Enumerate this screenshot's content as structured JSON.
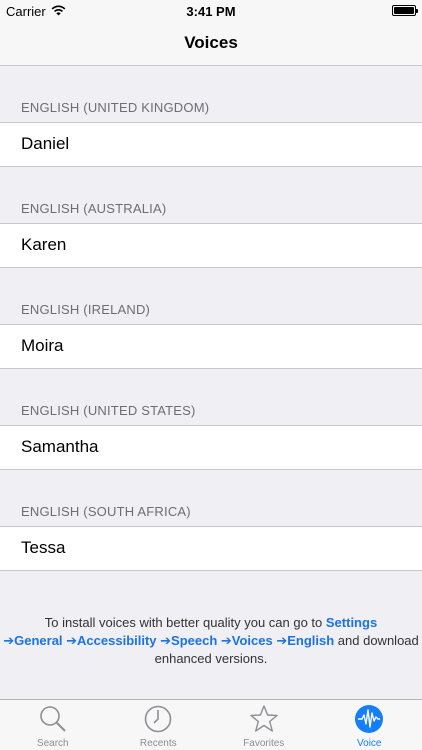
{
  "status": {
    "carrier": "Carrier",
    "time": "3:41 PM"
  },
  "nav": {
    "title": "Voices"
  },
  "sections": [
    {
      "header": "ENGLISH (UNITED KINGDOM)",
      "voice": "Daniel"
    },
    {
      "header": "ENGLISH (AUSTRALIA)",
      "voice": "Karen"
    },
    {
      "header": "ENGLISH (IRELAND)",
      "voice": "Moira"
    },
    {
      "header": "ENGLISH (UNITED STATES)",
      "voice": "Samantha"
    },
    {
      "header": "ENGLISH (SOUTH AFRICA)",
      "voice": "Tessa"
    }
  ],
  "footer": {
    "prefix": "To install voices with better quality you can go to ",
    "path_settings": "Settings",
    "path_rest": "➔General ➔Accessibility ➔Speech ➔Voices ➔English",
    "suffix": " and download enhanced versions."
  },
  "tabs": [
    {
      "label": "Search",
      "icon": "magnifier-icon"
    },
    {
      "label": "Recents",
      "icon": "clock-icon"
    },
    {
      "label": "Favorites",
      "icon": "star-icon"
    },
    {
      "label": "Voice",
      "icon": "waveform-icon"
    }
  ],
  "colors": {
    "accent": "#157efb",
    "link": "#1a73e8",
    "background": "#efeff4"
  }
}
